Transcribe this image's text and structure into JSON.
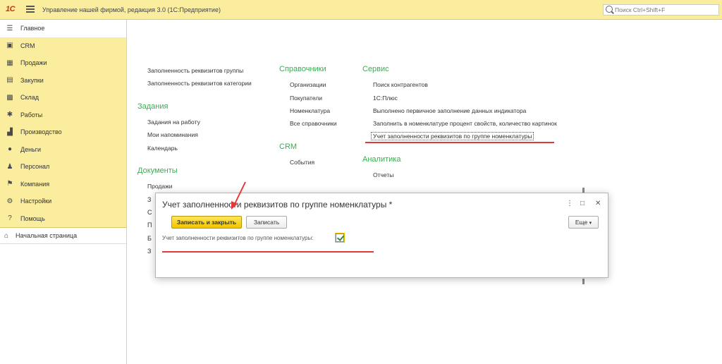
{
  "topbar": {
    "logo": "1С",
    "title": "Управление нашей фирмой, редакция 3.0  (1С:Предприятие)",
    "search_placeholder": "Поиск Ctrl+Shift+F"
  },
  "sidebar": {
    "items": [
      {
        "label": "Главное",
        "icon": "list-icon"
      },
      {
        "label": "CRM",
        "icon": "crm-icon"
      },
      {
        "label": "Продажи",
        "icon": "cart-icon"
      },
      {
        "label": "Закупки",
        "icon": "basket-icon"
      },
      {
        "label": "Склад",
        "icon": "grid-icon"
      },
      {
        "label": "Работы",
        "icon": "tools-icon"
      },
      {
        "label": "Производство",
        "icon": "factory-icon"
      },
      {
        "label": "Деньги",
        "icon": "money-icon"
      },
      {
        "label": "Персонал",
        "icon": "person-icon"
      },
      {
        "label": "Компания",
        "icon": "flag-icon"
      },
      {
        "label": "Настройки",
        "icon": "gear-icon"
      },
      {
        "label": "Помощь",
        "icon": "help-icon"
      }
    ],
    "home": "Начальная страница"
  },
  "main": {
    "col1": {
      "links_top": [
        "Заполненность реквизитов группы",
        "Заполненность реквизитов категории"
      ],
      "tasks_title": "Задания",
      "tasks": [
        "Задания на работу",
        "Мои напоминания",
        "Календарь"
      ],
      "docs_title": "Документы",
      "docs": [
        "Продажи"
      ],
      "partial": [
        "З",
        "С",
        "П",
        "Б",
        "З"
      ]
    },
    "col2": {
      "refs_title": "Справочники",
      "refs": [
        "Организации",
        "Покупатели",
        "Номенклатура",
        "Все справочники"
      ],
      "crm_title": "CRM",
      "crm": [
        "События"
      ]
    },
    "col3": {
      "service_title": "Сервис",
      "service": [
        "Поиск контрагентов",
        "1С:Плюс",
        "Выполнено первичное заполнение данных индикатора",
        "Заполнить в номенклатуре процент свойств, количество картинок",
        "Учет заполненности реквизитов по группе номенклатуры"
      ],
      "analytics_title": "Аналитика",
      "analytics": [
        "Отчеты"
      ]
    }
  },
  "dialog": {
    "title": "Учет заполненности реквизитов по группе номенклатуры *",
    "save_close": "Записать и закрыть",
    "save": "Записать",
    "more": "Еще",
    "checkbox_label": "Учет заполненности реквизитов по группе номенклатуры:",
    "checkbox_checked": true,
    "menu_glyph": "⋮",
    "maximize_glyph": "□",
    "close_glyph": "✕"
  },
  "colors": {
    "topbar": "#fbed9e",
    "group_title": "#3bab52",
    "primary_button": "#f1c400",
    "annotation": "#e23a3a"
  }
}
